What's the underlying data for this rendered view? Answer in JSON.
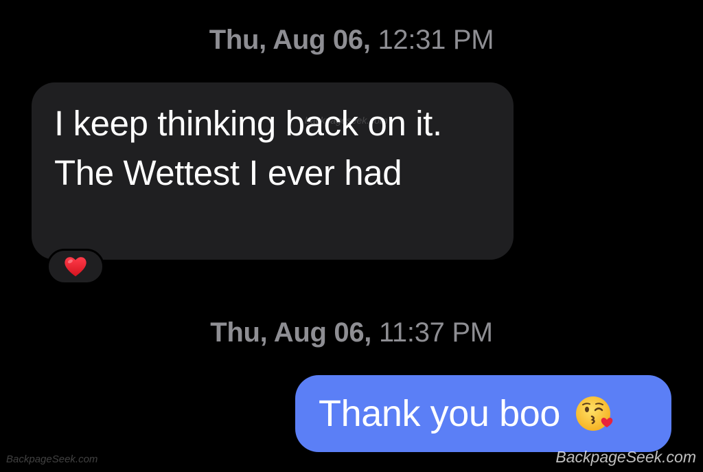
{
  "conversation": {
    "timestamp_1": {
      "day": "Thu, Aug 06,",
      "time": "12:31 PM"
    },
    "incoming_message": {
      "text": "I keep thinking back on it. The Wettest I ever had",
      "reaction": "heart-icon"
    },
    "timestamp_2": {
      "day": "Thu, Aug 06,",
      "time": "11:37 PM"
    },
    "outgoing_message": {
      "text": "Thank you boo",
      "emoji": "face-blowing-kiss-icon"
    }
  },
  "watermarks": {
    "inline": "backpageseek.com",
    "bottom_left": "BackpageSeek.com",
    "bottom_right": "BackpageSeek.com"
  },
  "colors": {
    "background": "#000000",
    "incoming_bubble": "#1f1f21",
    "outgoing_bubble": "#5b7ff6",
    "timestamp_text": "#8e8e93",
    "message_text": "#ffffff"
  }
}
